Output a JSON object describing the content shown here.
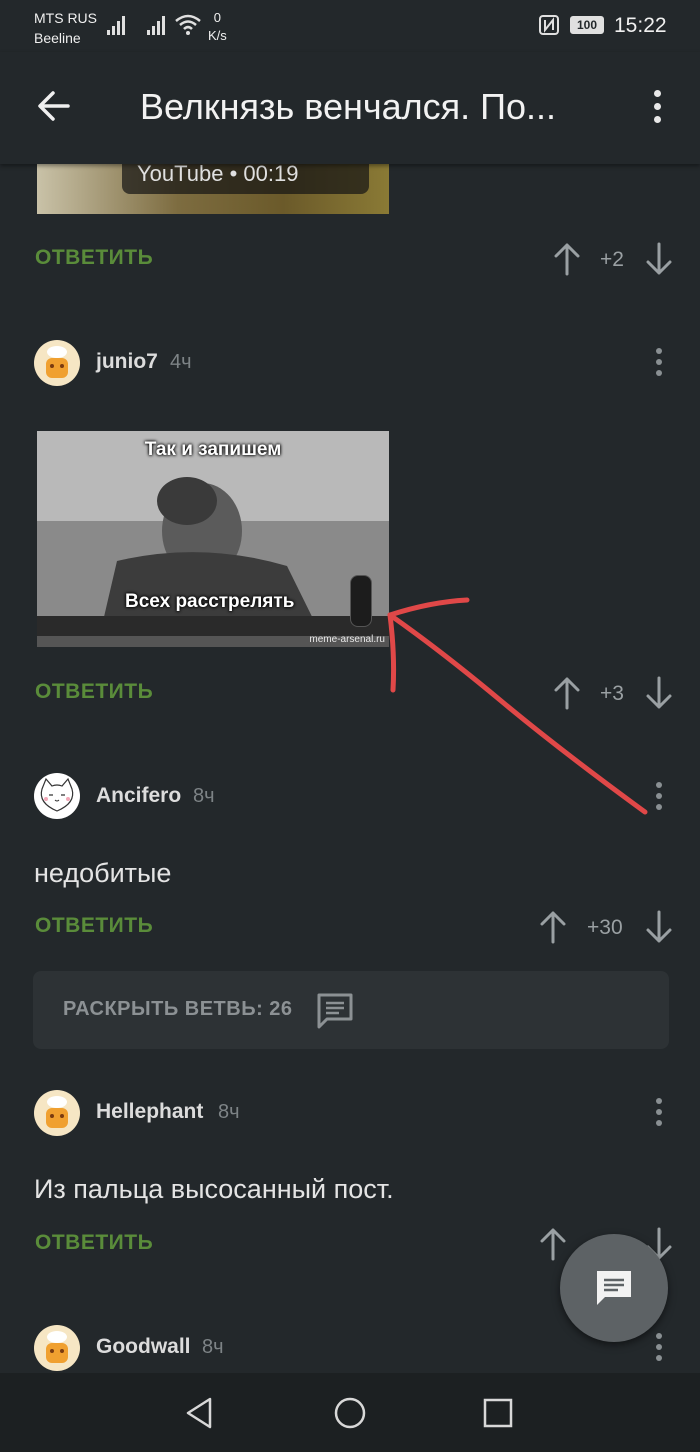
{
  "status_bar": {
    "carrier_line1": "MTS RUS",
    "carrier_line2": "Beeline",
    "net_speed_value": "0",
    "net_speed_unit": "K/s",
    "battery": "100",
    "time": "15:22"
  },
  "app_bar": {
    "title": "Велкнязь венчался. По...",
    "back_icon": "arrow-left-icon",
    "menu_icon": "more-vertical-icon"
  },
  "video": {
    "overlay_text": "YouTube • 00:19"
  },
  "comments": [
    {
      "reply_label": "ОТВЕТИТЬ",
      "score": "+2"
    },
    {
      "author": "junio7",
      "time": "4ч",
      "meme_top_text": "Так и запишем",
      "meme_bottom_text": "Всех расстрелять",
      "meme_watermark": "meme-arsenal.ru",
      "reply_label": "ОТВЕТИТЬ",
      "score": "+3"
    },
    {
      "author": "Ancifero",
      "time": "8ч",
      "text": "недобитые",
      "reply_label": "ОТВЕТИТЬ",
      "score": "+30"
    },
    {
      "author": "Hellephant",
      "time": "8ч",
      "text": "Из пальца высосанный пост.",
      "reply_label": "ОТВЕТИТЬ"
    },
    {
      "author": "Goodwall",
      "time": "8ч"
    }
  ],
  "expand_thread": {
    "label": "РАСКРЫТЬ ВЕТВЬ: 26"
  },
  "colors": {
    "background": "#23282b",
    "reply_green": "#5a8c3a",
    "annotation_red": "#e04848"
  }
}
